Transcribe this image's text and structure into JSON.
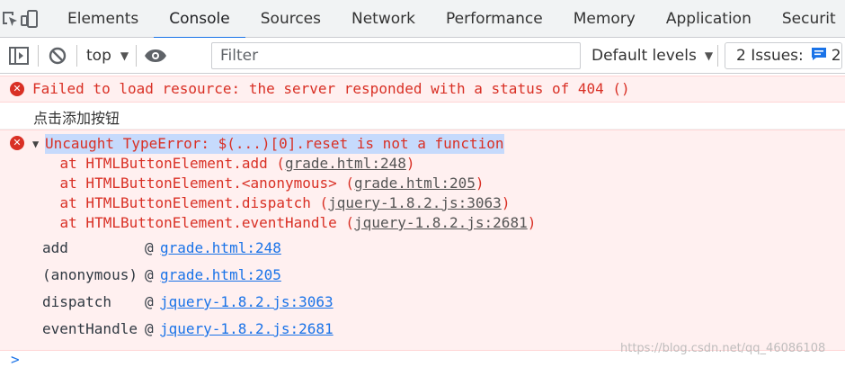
{
  "tabs": [
    "Elements",
    "Console",
    "Sources",
    "Network",
    "Performance",
    "Memory",
    "Application",
    "Securit"
  ],
  "active_tab": "Console",
  "toolbar": {
    "context": "top",
    "filter_placeholder": "Filter",
    "levels": "Default levels",
    "issues_label": "2 Issues:",
    "issues_count": "2"
  },
  "messages": {
    "error1": "Failed to load resource: the server responded with a status of 404 ()",
    "log1": "点击添加按钮",
    "error2": {
      "summary": "Uncaught TypeError: $(...)[0].reset is not a function",
      "frames": [
        {
          "prefix": "    at HTMLButtonElement.add (",
          "link": "grade.html:248",
          "suffix": ")"
        },
        {
          "prefix": "    at HTMLButtonElement.<anonymous> (",
          "link": "grade.html:205",
          "suffix": ")"
        },
        {
          "prefix": "    at HTMLButtonElement.dispatch (",
          "link": "jquery-1.8.2.js:3063",
          "suffix": ")"
        },
        {
          "prefix": "    at HTMLButtonElement.eventHandle (",
          "link": "jquery-1.8.2.js:2681",
          "suffix": ")"
        }
      ],
      "trace": [
        {
          "fn": "add",
          "at": "@",
          "link": "grade.html:248"
        },
        {
          "fn": "(anonymous)",
          "at": "@",
          "link": "grade.html:205"
        },
        {
          "fn": "dispatch",
          "at": "@",
          "link": "jquery-1.8.2.js:3063"
        },
        {
          "fn": "eventHandle",
          "at": "@",
          "link": "jquery-1.8.2.js:2681"
        }
      ]
    }
  },
  "prompt_symbol": ">",
  "watermark": "https://blog.csdn.net/qq_46086108",
  "colors": {
    "error": "#d93025",
    "accent": "#1a73e8",
    "error_bg": "#fff0f0",
    "selection": "#c6dafc"
  }
}
